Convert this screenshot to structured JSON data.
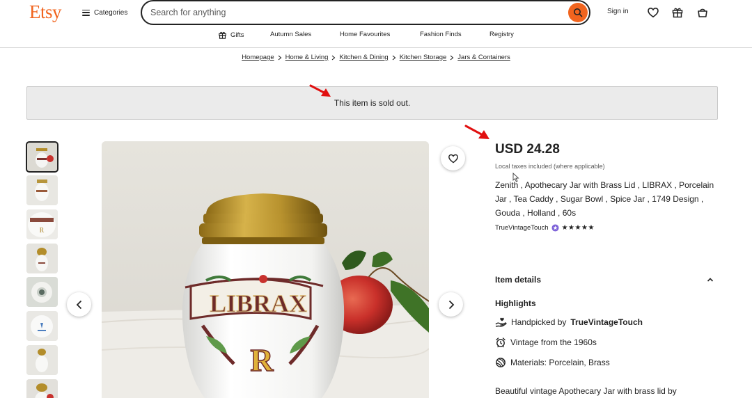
{
  "header": {
    "logo": "Etsy",
    "categories_label": "Categories",
    "search_placeholder": "Search for anything",
    "signin_label": "Sign in"
  },
  "nav": {
    "items": [
      "Gifts",
      "Autumn Sales",
      "Home Favourites",
      "Fashion Finds",
      "Registry"
    ]
  },
  "breadcrumb": [
    "Homepage",
    "Home & Living",
    "Kitchen & Dining",
    "Kitchen Storage",
    "Jars & Containers"
  ],
  "banner": {
    "text": "This item is sold out."
  },
  "product": {
    "price": "USD 24.28",
    "taxes_note": "Local taxes included (where applicable)",
    "title": "Zenith , Apothecary Jar with Brass Lid , LIBRAX , Porcelain Jar , Tea Caddy , Sugar Bowl , Spice Jar , 1749 Design , Gouda , Holland , 60s",
    "shop_name": "TrueVintageTouch",
    "rating_stars": "★★★★★",
    "rating_value": 5,
    "item_details_label": "Item details",
    "highlights_label": "Highlights",
    "highlights": {
      "handpicked_prefix": "Handpicked by",
      "handpicked_shop": "TrueVintageTouch",
      "vintage": "Vintage from the 1960s",
      "materials": "Materials: Porcelain, Brass"
    },
    "description_start": "Beautiful vintage Apothecary Jar with brass lid by"
  },
  "image": {
    "jar_label": "LIBRAX",
    "jar_letter": "R"
  },
  "colors": {
    "brand": "#F1641E",
    "banner_bg": "#ebebeb",
    "text": "#222222",
    "annotation_arrow": "#e11010"
  }
}
